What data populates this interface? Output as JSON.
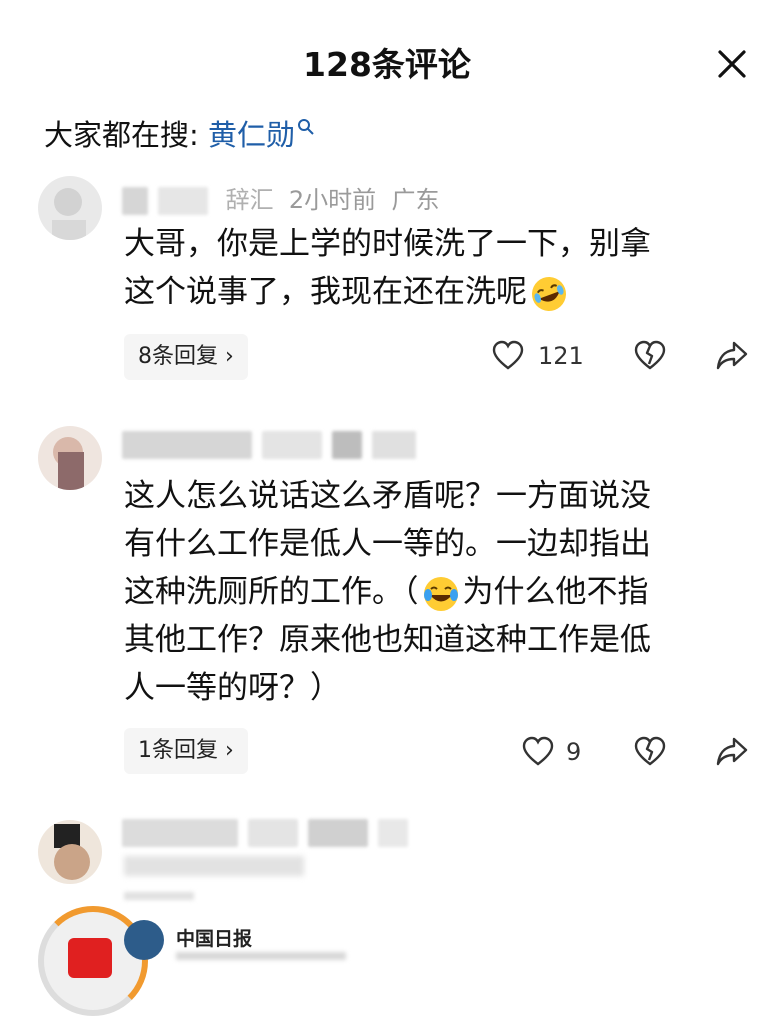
{
  "header": {
    "title": "128条评论"
  },
  "search": {
    "label": "大家都在搜:",
    "term": "黄仁勋"
  },
  "comments": [
    {
      "meta": {
        "name_fragment": "辞汇",
        "time": "2小时前",
        "location": "广东"
      },
      "text_line1": "大哥，你是上学的时候洗了一下，别拿",
      "text_line2": "这个说事了，我现在还在洗呢",
      "replies": "8条回复",
      "likes": "121"
    },
    {
      "text_line1": "这人怎么说话这么矛盾呢？一方面说没",
      "text_line2": "有什么工作是低人一等的。一边却指出",
      "text_line3_a": "这种洗厕所的工作。（",
      "text_line3_b": "为什么他不指",
      "text_line4": "其他工作？原来他也知道这种工作是低",
      "text_line5": "人一等的呀？）",
      "replies": "1条回复",
      "likes": "9"
    }
  ],
  "bottom": {
    "source_name": "中国日报"
  }
}
